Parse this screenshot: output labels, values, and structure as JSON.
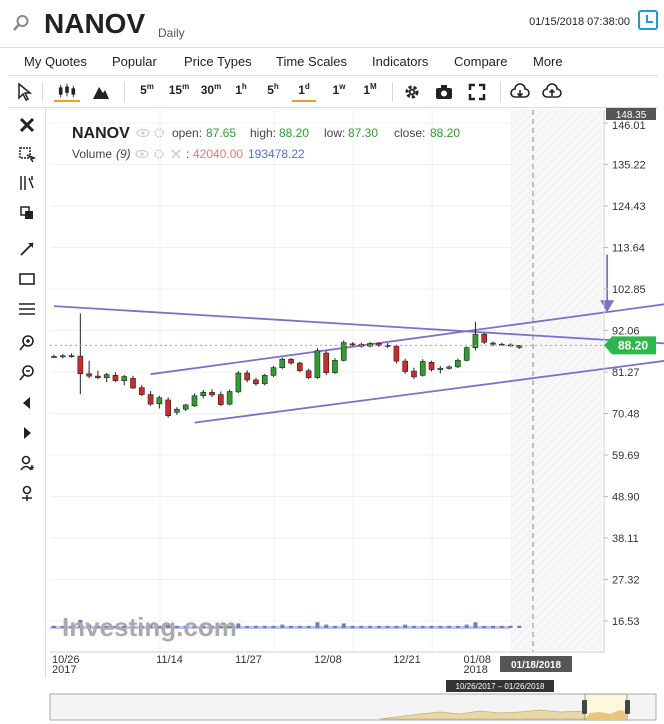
{
  "header": {
    "symbol": "NANOV",
    "period": "Daily",
    "datetime": "01/15/2018 07:38:00",
    "icons": {
      "search": "search-icon",
      "clock": "clock-icon"
    }
  },
  "menu": [
    {
      "id": "my-quotes",
      "label": "My Quotes"
    },
    {
      "id": "popular",
      "label": "Popular"
    },
    {
      "id": "price-types",
      "label": "Price Types"
    },
    {
      "id": "time-scales",
      "label": "Time Scales"
    },
    {
      "id": "indicators",
      "label": "Indicators"
    },
    {
      "id": "compare",
      "label": "Compare"
    },
    {
      "id": "more",
      "label": "More"
    }
  ],
  "toolbar": {
    "intervals": [
      {
        "id": "5m",
        "base": "5",
        "sup": "m"
      },
      {
        "id": "15m",
        "base": "15",
        "sup": "m"
      },
      {
        "id": "30m",
        "base": "30",
        "sup": "m"
      },
      {
        "id": "1h",
        "base": "1",
        "sup": "h"
      },
      {
        "id": "5h",
        "base": "5",
        "sup": "h"
      },
      {
        "id": "1d",
        "base": "1",
        "sup": "d"
      },
      {
        "id": "1w",
        "base": "1",
        "sup": "w"
      },
      {
        "id": "1M",
        "base": "1",
        "sup": "M"
      }
    ],
    "active_interval": "1d"
  },
  "colors": {
    "up": "#2ca02c",
    "down": "#d62728",
    "trendline": "#7b72c8",
    "volume": "#6f7fc4",
    "last_price_bg": "#2db84b",
    "accent": "#f0a01e",
    "grid": "#f0f0f0"
  },
  "chart_data": {
    "type": "candlestick",
    "symbol": "NANOV",
    "legend": {
      "open_label": "open:",
      "open": "87.65",
      "high_label": "high:",
      "high": "88.20",
      "low_label": "low:",
      "low": "87.30",
      "close_label": "close:",
      "close": "88.20",
      "volume_label": "Volume",
      "volume_period": "(9)",
      "volume_value": "42040.00",
      "volume_ma": "193478.22"
    },
    "y_ticks": [
      "146.01",
      "135.22",
      "124.43",
      "113.64",
      "102.85",
      "92.06",
      "81.27",
      "70.48",
      "59.69",
      "48.90",
      "38.11",
      "27.32",
      "16.53"
    ],
    "y_top_label": "148.35",
    "last_price_label": "88.20",
    "last_price": 88.2,
    "ylim": [
      16.53,
      146.01
    ],
    "x_ticks": [
      {
        "label": "10/26",
        "sub": "2017",
        "index": 0
      },
      {
        "label": "11/14",
        "sub": "",
        "index": 13
      },
      {
        "label": "11/27",
        "sub": "",
        "index": 22
      },
      {
        "label": "12/08",
        "sub": "",
        "index": 31
      },
      {
        "label": "12/21",
        "sub": "",
        "index": 40
      },
      {
        "label": "01/08",
        "sub": "2018",
        "index": 48
      }
    ],
    "cursor_date": "01/18/2018",
    "navigator_range": "10/26/2017 – 01/26/2018",
    "candles": [
      [
        85.3,
        85.8,
        84.9,
        85.2
      ],
      [
        85.2,
        85.9,
        84.8,
        85.5
      ],
      [
        85.5,
        86.1,
        85.0,
        85.4
      ],
      [
        85.4,
        96.5,
        75.5,
        80.8
      ],
      [
        80.8,
        84.2,
        79.6,
        80.2
      ],
      [
        80.2,
        81.6,
        79.4,
        79.8
      ],
      [
        79.8,
        81.0,
        78.6,
        80.6
      ],
      [
        80.4,
        81.2,
        78.6,
        79.0
      ],
      [
        79.0,
        80.5,
        77.8,
        80.1
      ],
      [
        79.6,
        80.3,
        76.9,
        77.1
      ],
      [
        77.2,
        77.9,
        75.0,
        75.4
      ],
      [
        75.4,
        76.3,
        72.5,
        72.9
      ],
      [
        73.0,
        75.1,
        71.8,
        74.6
      ],
      [
        74.0,
        74.7,
        69.4,
        69.9
      ],
      [
        70.8,
        72.1,
        70.1,
        71.6
      ],
      [
        71.6,
        73.0,
        71.1,
        72.7
      ],
      [
        72.5,
        75.7,
        72.2,
        75.1
      ],
      [
        75.1,
        76.6,
        74.4,
        76.0
      ],
      [
        76.0,
        76.8,
        74.7,
        75.3
      ],
      [
        75.4,
        76.2,
        72.4,
        72.8
      ],
      [
        72.9,
        76.7,
        72.6,
        76.2
      ],
      [
        76.1,
        81.5,
        75.8,
        81.0
      ],
      [
        81.0,
        81.7,
        78.6,
        79.2
      ],
      [
        79.2,
        79.8,
        77.7,
        78.2
      ],
      [
        78.2,
        80.8,
        77.8,
        80.4
      ],
      [
        80.4,
        82.8,
        80.0,
        82.4
      ],
      [
        82.4,
        85.0,
        82.0,
        84.6
      ],
      [
        84.6,
        84.9,
        83.2,
        83.6
      ],
      [
        83.6,
        83.9,
        81.2,
        81.6
      ],
      [
        81.6,
        82.1,
        79.4,
        79.8
      ],
      [
        79.8,
        87.5,
        79.5,
        86.8
      ],
      [
        86.2,
        86.8,
        80.5,
        81.1
      ],
      [
        81.1,
        84.9,
        80.8,
        84.3
      ],
      [
        84.3,
        89.5,
        84.0,
        88.9
      ],
      [
        88.6,
        89.0,
        88.0,
        88.4
      ],
      [
        88.4,
        88.9,
        87.6,
        88.0
      ],
      [
        88.0,
        89.1,
        87.7,
        88.7
      ],
      [
        88.7,
        89.0,
        87.8,
        88.2
      ],
      [
        88.2,
        88.8,
        87.5,
        88.0
      ],
      [
        88.0,
        88.4,
        83.5,
        84.1
      ],
      [
        84.1,
        84.7,
        80.8,
        81.4
      ],
      [
        81.5,
        82.4,
        79.4,
        80.0
      ],
      [
        80.4,
        84.6,
        80.1,
        84.0
      ],
      [
        83.8,
        84.2,
        81.4,
        81.9
      ],
      [
        81.9,
        82.8,
        80.9,
        82.2
      ],
      [
        82.2,
        83.0,
        81.9,
        82.6
      ],
      [
        82.6,
        84.8,
        82.3,
        84.3
      ],
      [
        84.3,
        87.9,
        84.0,
        87.6
      ],
      [
        87.6,
        94.3,
        86.9,
        91.1
      ],
      [
        91.1,
        91.4,
        88.5,
        89.0
      ],
      [
        88.8,
        89.2,
        88.0,
        88.5
      ],
      [
        88.5,
        88.9,
        88.1,
        88.3
      ],
      [
        88.3,
        88.7,
        87.9,
        88.2
      ],
      [
        87.65,
        88.2,
        87.3,
        88.2
      ]
    ],
    "volumes": [
      1,
      1,
      1,
      6,
      2,
      1,
      1,
      1,
      1,
      1,
      1,
      2,
      1,
      2,
      1,
      1,
      1,
      1,
      1,
      1,
      1,
      3,
      1,
      1,
      1,
      1,
      2,
      1,
      1,
      1,
      4,
      2,
      1,
      3,
      1,
      1,
      1,
      1,
      1,
      1,
      2,
      1,
      1,
      1,
      1,
      1,
      1,
      2,
      4,
      1,
      1,
      1,
      1,
      1
    ],
    "trendlines": [
      {
        "name": "upper-channel",
        "from": [
          11,
          80.7
        ],
        "to": [
          76,
          100.9
        ]
      },
      {
        "name": "lower-channel",
        "from": [
          16,
          68.1
        ],
        "to": [
          76,
          86.1
        ]
      },
      {
        "name": "descending-line",
        "from": [
          0,
          98.4
        ],
        "to": [
          76,
          87.8
        ]
      }
    ],
    "arrow": {
      "index": 63,
      "from_value": 111.8,
      "to_value": 96.8
    },
    "watermark": "Investing.com"
  }
}
